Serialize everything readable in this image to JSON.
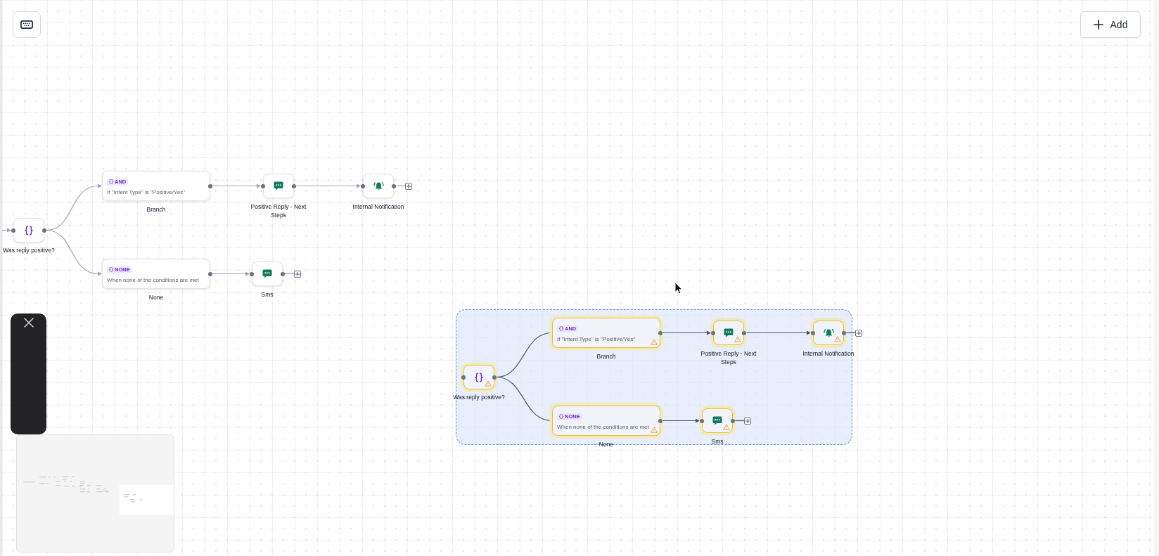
{
  "toolbar": {
    "add_button": {
      "label": "Add"
    }
  },
  "flows": [
    {
      "selected": false,
      "incoming": true,
      "condition": {
        "label": "Was reply positive?",
        "warning": false
      },
      "branches": [
        {
          "tag": "AND",
          "text": "If \"Intent Type\" is \"Positive/Yes\"",
          "label": "Branch",
          "warning": false,
          "steps": [
            {
              "kind": "message",
              "label": "Positive Reply - Next Steps",
              "warning": false
            },
            {
              "kind": "notification",
              "label": "Internal Notification",
              "warning": false,
              "add_step": true
            }
          ]
        },
        {
          "tag": "NONE",
          "text": "When none of the conditions are met",
          "label": "None",
          "warning": false,
          "steps": [
            {
              "kind": "message",
              "label": "Sms",
              "warning": false,
              "add_step": true
            }
          ]
        }
      ]
    },
    {
      "selected": true,
      "incoming": false,
      "condition": {
        "label": "Was reply positive?",
        "warning": true
      },
      "branches": [
        {
          "tag": "AND",
          "text": "If \"Intent Type\" is \"Positive/Yes\"",
          "label": "Branch",
          "warning": true,
          "steps": [
            {
              "kind": "message",
              "label": "Positive Reply - Next Steps",
              "warning": true
            },
            {
              "kind": "notification",
              "label": "Internal Notification",
              "warning": true,
              "add_step": true
            }
          ]
        },
        {
          "tag": "NONE",
          "text": "When none of the conditions are met",
          "label": "None",
          "warning": true,
          "steps": [
            {
              "kind": "message",
              "label": "Sms",
              "warning": true,
              "add_step": true
            }
          ]
        }
      ]
    }
  ]
}
